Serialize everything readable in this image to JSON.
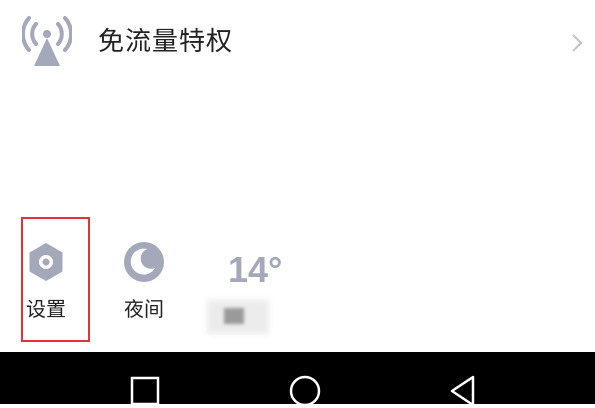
{
  "free_data_row": {
    "title": "免流量特权",
    "icon": "signal-tower-icon",
    "chevron": "chevron-right-icon"
  },
  "quick_settings": [
    {
      "label": "设置",
      "icon": "settings-hex-icon",
      "highlighted": true
    },
    {
      "label": "夜间",
      "icon": "moon-icon",
      "highlighted": false
    }
  ],
  "weather": {
    "temperature": "14°"
  },
  "nav_bar": {
    "buttons": [
      "recent-apps-icon",
      "home-icon",
      "back-icon"
    ]
  },
  "colors": {
    "icon_gray": "#a3a8ba",
    "highlight": "#e2333a",
    "text": "#222222",
    "nav_bg": "#000000"
  }
}
